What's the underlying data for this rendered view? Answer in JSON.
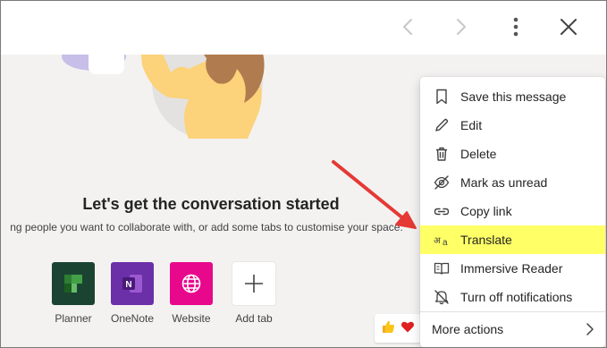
{
  "header": {
    "prev_icon": "chevron-left-icon",
    "next_icon": "chevron-right-icon",
    "more_icon": "more-vertical-icon",
    "close_icon": "close-icon"
  },
  "main": {
    "title": "Let's get the conversation started",
    "subtitle": "ng people you want to collaborate with, or add some tabs to customise your space.",
    "apps": [
      {
        "label": "Planner",
        "color": "#1b4332"
      },
      {
        "label": "OneNote",
        "color": "#6b2fa8"
      },
      {
        "label": "Website",
        "color": "#e8088c"
      },
      {
        "label": "Add tab",
        "color": "#ffffff"
      }
    ]
  },
  "menu": {
    "items": [
      {
        "label": "Save this message",
        "icon": "bookmark-icon"
      },
      {
        "label": "Edit",
        "icon": "pencil-icon"
      },
      {
        "label": "Delete",
        "icon": "trash-icon"
      },
      {
        "label": "Mark as unread",
        "icon": "eye-off-icon"
      },
      {
        "label": "Copy link",
        "icon": "link-icon"
      },
      {
        "label": "Translate",
        "icon": "translate-icon",
        "highlighted": true
      },
      {
        "label": "Immersive Reader",
        "icon": "immersive-reader-icon"
      },
      {
        "label": "Turn off notifications",
        "icon": "bell-off-icon"
      }
    ],
    "more": {
      "label": "More actions",
      "icon": "chevron-right-icon"
    }
  },
  "translate_glyph": "अ",
  "reactions": [
    "thumbs-up-icon",
    "heart-icon"
  ],
  "colors": {
    "highlight": "#ffff66",
    "arrow": "#e53935",
    "content_bg": "#f3f2f1"
  }
}
